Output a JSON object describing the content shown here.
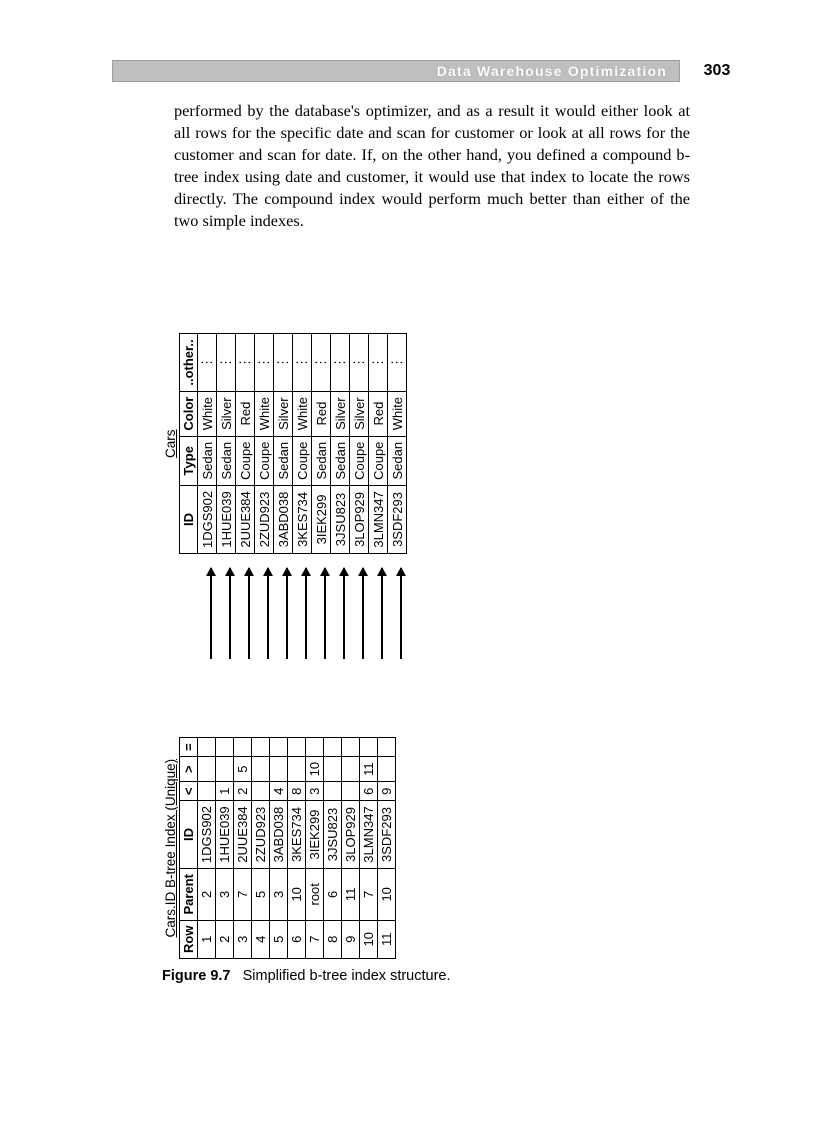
{
  "header": {
    "title": "Data Warehouse Optimization",
    "page": "303"
  },
  "paragraph": "performed by the database's optimizer, and as a result it would either look at all rows for the specific date and scan for customer or look at all rows for the customer and scan for date. If, on the other hand, you defined a compound b-tree index using date and customer, it would use that index to locate the rows directly. The compound index would perform much better than either of the two simple indexes.",
  "figure": {
    "label": "Figure 9.7",
    "caption": "Simplified b-tree index structure."
  },
  "chart_data": {
    "type": "table",
    "index_table": {
      "title": "Cars.ID B-tree Index (Unique)",
      "columns": [
        "Row",
        "Parent",
        "ID",
        "<",
        ">",
        "="
      ],
      "rows": [
        [
          "1",
          "2",
          "1DGS902",
          "",
          "",
          ""
        ],
        [
          "2",
          "3",
          "1HUE039",
          "1",
          "",
          ""
        ],
        [
          "3",
          "7",
          "2UUE384",
          "2",
          "5",
          ""
        ],
        [
          "4",
          "5",
          "2ZUD923",
          "",
          "",
          ""
        ],
        [
          "5",
          "3",
          "3ABD038",
          "4",
          "",
          ""
        ],
        [
          "6",
          "10",
          "3KES734",
          "8",
          "",
          ""
        ],
        [
          "7",
          "root",
          "3IEK299",
          "3",
          "10",
          ""
        ],
        [
          "8",
          "6",
          "3JSU823",
          "",
          "",
          ""
        ],
        [
          "9",
          "11",
          "3LOP929",
          "",
          "",
          ""
        ],
        [
          "10",
          "7",
          "3LMN347",
          "6",
          "11",
          ""
        ],
        [
          "11",
          "10",
          "3SDF293",
          "9",
          "",
          ""
        ]
      ]
    },
    "cars_table": {
      "title": "Cars",
      "columns": [
        "ID",
        "Type",
        "Color",
        "..other.."
      ],
      "rows": [
        [
          "1DGS902",
          "Sedan",
          "White",
          "⋮"
        ],
        [
          "1HUE039",
          "Sedan",
          "Silver",
          "⋮"
        ],
        [
          "2UUE384",
          "Coupe",
          "Red",
          "⋮"
        ],
        [
          "2ZUD923",
          "Coupe",
          "White",
          "⋮"
        ],
        [
          "3ABD038",
          "Sedan",
          "Silver",
          "⋮"
        ],
        [
          "3KES734",
          "Coupe",
          "White",
          "⋮"
        ],
        [
          "3IEK299",
          "Sedan",
          "Red",
          "⋮"
        ],
        [
          "3JSU823",
          "Sedan",
          "Silver",
          "⋮"
        ],
        [
          "3LOP929",
          "Coupe",
          "Silver",
          "⋮"
        ],
        [
          "3LMN347",
          "Coupe",
          "Red",
          "⋮"
        ],
        [
          "3SDF293",
          "Sedan",
          "White",
          "⋮"
        ]
      ]
    }
  }
}
